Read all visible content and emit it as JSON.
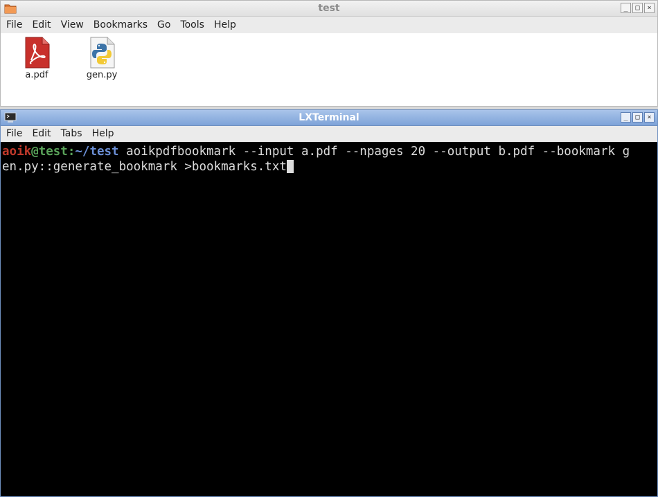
{
  "file_manager": {
    "title": "test",
    "menu": [
      "File",
      "Edit",
      "View",
      "Bookmarks",
      "Go",
      "Tools",
      "Help"
    ],
    "files": [
      {
        "name": "a.pdf",
        "icon": "pdf-file-icon"
      },
      {
        "name": "gen.py",
        "icon": "python-file-icon"
      }
    ]
  },
  "terminal": {
    "title": "LXTerminal",
    "menu": [
      "File",
      "Edit",
      "Tabs",
      "Help"
    ],
    "prompt": {
      "user": "aoik",
      "at_host": "@test:",
      "path": "~/test"
    },
    "command_line_1": " aoikpdfbookmark --input a.pdf --npages 20 --output b.pdf --bookmark g",
    "command_line_2": "en.py::generate_bookmark >bookmarks.txt"
  },
  "window_buttons": {
    "minimize": "_",
    "maximize": "□",
    "close": "×"
  },
  "colors": {
    "prompt_user": "#c0392b",
    "prompt_at": "#5aa35a",
    "prompt_path": "#6b8fd6",
    "terminal_bg": "#000000",
    "terminal_fg": "#dcdcdc",
    "active_titlebar": "#7ea3d8"
  }
}
